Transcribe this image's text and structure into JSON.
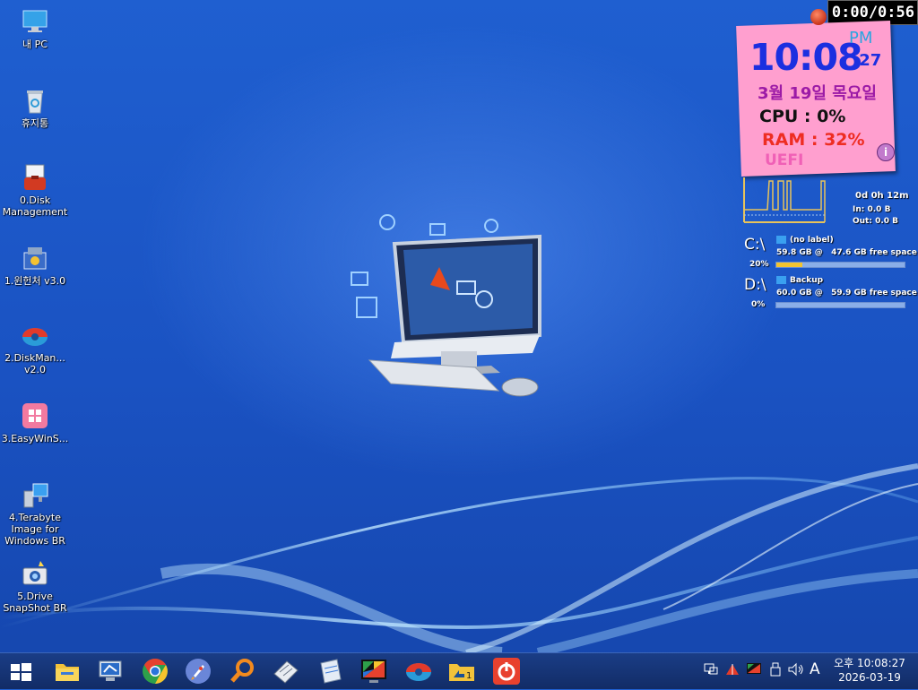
{
  "timer": "0:00/0:56",
  "desktop_icons": [
    {
      "label": "내 PC"
    },
    {
      "label": "휴지통"
    },
    {
      "label": "0.Disk Management"
    },
    {
      "label": "1.윈헌처 v3.0"
    },
    {
      "label": "2.DiskMan... v2.0"
    },
    {
      "label": "3.EasyWinS..."
    },
    {
      "label": "4.Terabyte Image for Windows BR"
    },
    {
      "label": "5.Drive SnapShot BR"
    }
  ],
  "clock_widget": {
    "time": "10:08",
    "ampm": "PM",
    "seconds": ":27",
    "date": "3월 19일 목요일",
    "cpu": "CPU :  0%",
    "ram": "RAM :  32%",
    "firmware": "UEFI",
    "info_icon": "i"
  },
  "network_meter": {
    "uptime": "0d 0h 12m",
    "in": "In: 0.0 B",
    "out": "Out: 0.0 B"
  },
  "drives": [
    {
      "letter": "C:\\",
      "label": "(no label)",
      "size": "59.8 GB @",
      "free": "47.6 GB free space",
      "used_pct_text": "20%",
      "used_fraction": 0.2
    },
    {
      "letter": "D:\\",
      "label": "Backup",
      "size": "60.0 GB @",
      "free": "59.9 GB free space",
      "used_pct_text": "0%",
      "used_fraction": 0.0
    }
  ],
  "taskbar": {
    "apps": [
      "start-button",
      "file-explorer",
      "computer-management",
      "chrome",
      "rocket-launcher",
      "search-tool",
      "keyboard-tool",
      "notepad-tool",
      "display-tool",
      "diskman-tool",
      "folder-shortcut",
      "power-button"
    ],
    "tray_input": "A",
    "clock_time": "오후 10:08:27",
    "clock_date": "2026-03-19"
  }
}
